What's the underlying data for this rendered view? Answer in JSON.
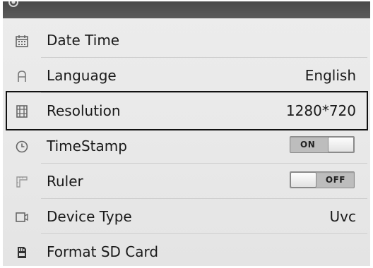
{
  "settings": {
    "header_icon": "gear-icon",
    "items": [
      {
        "label": "Date Time",
        "icon": "calendar-icon"
      },
      {
        "label": "Language",
        "value": "English",
        "icon": "letter-a-icon"
      },
      {
        "label": "Resolution",
        "value": "1280*720",
        "icon": "film-icon",
        "selected": true
      },
      {
        "label": "TimeStamp",
        "icon": "clock-icon",
        "toggle": {
          "state": "ON",
          "on": true
        }
      },
      {
        "label": "Ruler",
        "icon": "ruler-icon",
        "toggle": {
          "state": "OFF",
          "on": false
        }
      },
      {
        "label": "Device Type",
        "value": "Uvc",
        "icon": "video-camera-icon"
      },
      {
        "label": "Format SD Card",
        "icon": "sd-card-icon"
      }
    ]
  },
  "colors": {
    "background": "#e9e9e9",
    "text": "#1a1a1a",
    "selection_border": "#111111"
  }
}
